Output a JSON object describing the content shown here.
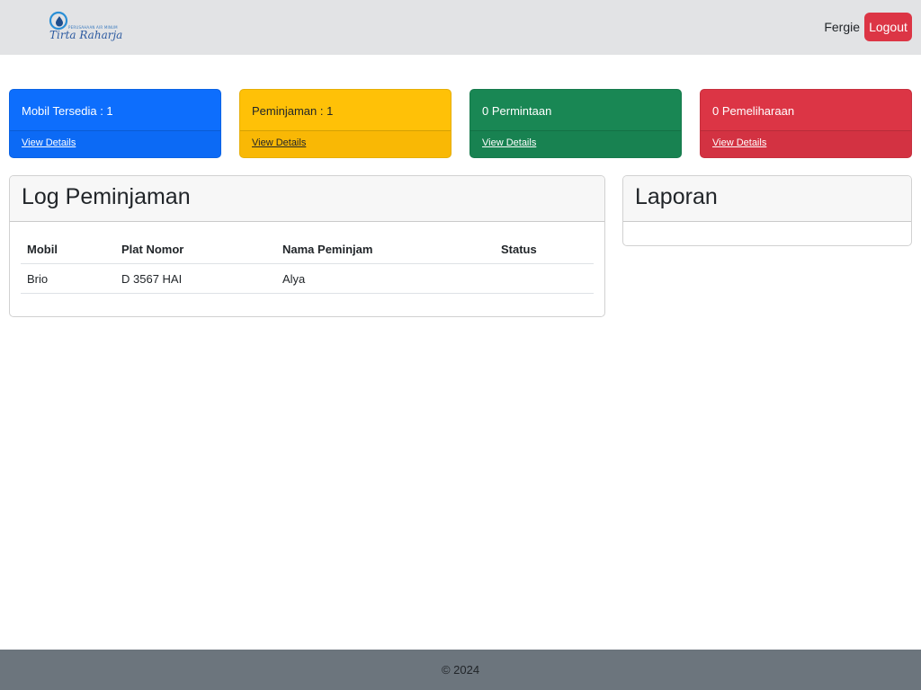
{
  "navbar": {
    "logo_small_text": "PERUSAHAAN AIR MINUM",
    "logo_text": "Tirta Raharja",
    "user_name": "Fergie",
    "logout_label": "Logout"
  },
  "stats": [
    {
      "label": "Mobil Tersedia : 1",
      "link": "View Details",
      "color": "#0d6efd"
    },
    {
      "label": "Peminjaman : 1",
      "link": "View Details",
      "color": "#ffc107"
    },
    {
      "label": "0 Permintaan",
      "link": "View Details",
      "color": "#198754"
    },
    {
      "label": "0 Pemeliharaan",
      "link": "View Details",
      "color": "#dc3545"
    }
  ],
  "log": {
    "title": "Log Peminjaman",
    "columns": [
      "Mobil",
      "Plat Nomor",
      "Nama Peminjam",
      "Status"
    ],
    "rows": [
      {
        "mobil": "Brio",
        "plat": "D 3567 HAI",
        "nama": "Alya",
        "status": ""
      }
    ]
  },
  "report": {
    "title": "Laporan"
  },
  "footer": {
    "text": "© 2024"
  },
  "colors": {
    "navbar_bg": "#e2e3e5",
    "danger": "#dc3545",
    "footer_bg": "#6c757d"
  }
}
